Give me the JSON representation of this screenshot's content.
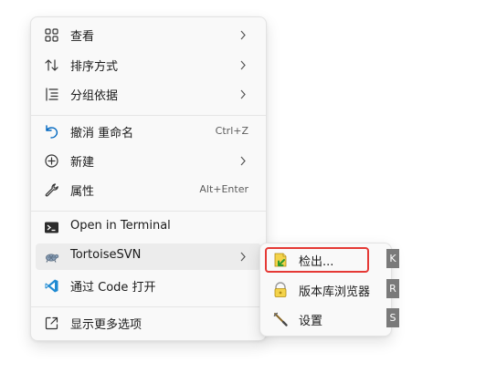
{
  "context_menu": {
    "items": [
      {
        "label": "查看",
        "icon": "grid-icon"
      },
      {
        "label": "排序方式",
        "icon": "sort-arrows-icon"
      },
      {
        "label": "分组依据",
        "icon": "list-group-icon"
      },
      {
        "label": "撤消 重命名",
        "shortcut": "Ctrl+Z",
        "icon": "undo-icon"
      },
      {
        "label": "新建",
        "icon": "new-circle-plus-icon"
      },
      {
        "label": "属性",
        "shortcut": "Alt+Enter",
        "icon": "wrench-icon"
      },
      {
        "label": "Open in Terminal",
        "icon": "terminal-icon"
      },
      {
        "label": "TortoiseSVN",
        "icon": "tortoisesvn-icon"
      },
      {
        "label": "通过 Code 打开",
        "icon": "vscode-icon"
      },
      {
        "label": "显示更多选项",
        "icon": "more-options-icon"
      }
    ]
  },
  "submenu": {
    "items": [
      {
        "label": "检出...",
        "icon": "svn-checkout-icon",
        "access_key": "K"
      },
      {
        "label": "版本库浏览器",
        "icon": "repo-browser-icon",
        "access_key": "R"
      },
      {
        "label": "设置",
        "icon": "svn-settings-icon",
        "access_key": "S"
      }
    ]
  },
  "colors": {
    "menu_bg": "#f9f9f9",
    "hover_bg": "#ececec",
    "highlight_border": "#e53935",
    "key_badge_bg": "#7a7a7a",
    "accent_blue": "#0067c0"
  }
}
